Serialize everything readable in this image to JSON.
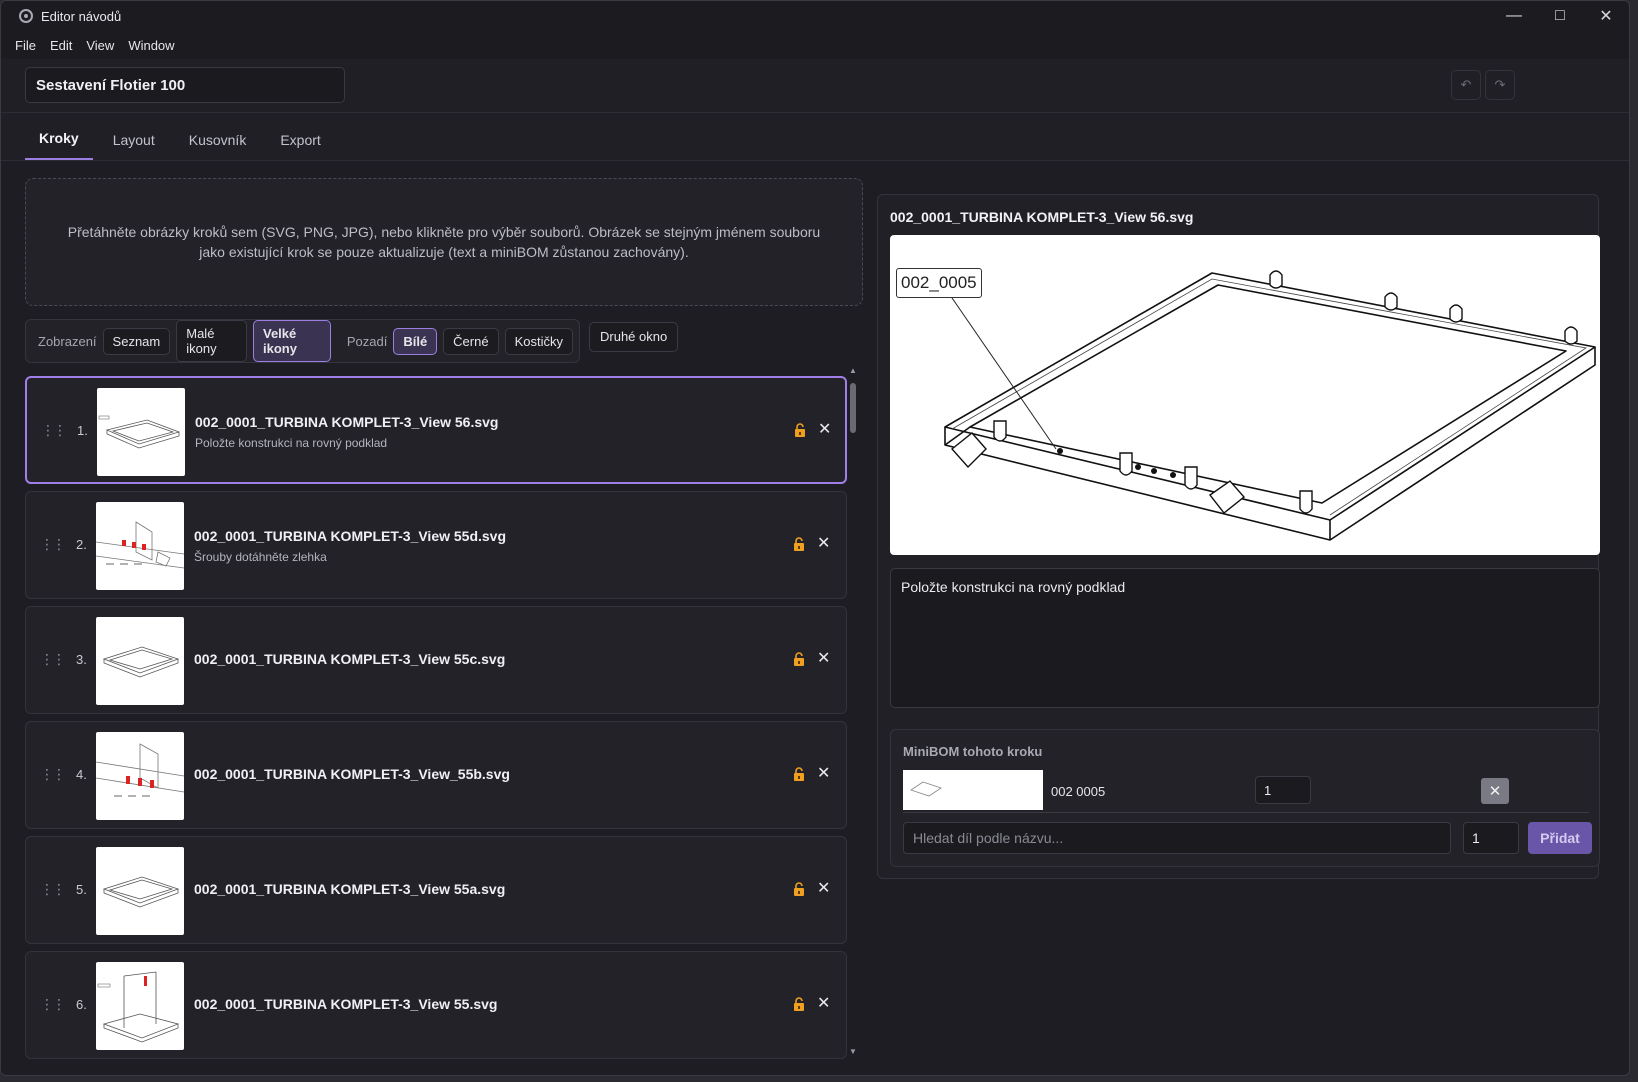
{
  "window": {
    "title": "Editor návodů"
  },
  "menu": [
    "File",
    "Edit",
    "View",
    "Window"
  ],
  "header": {
    "doc_title": "Sestavení Flotier 100"
  },
  "tabs": [
    {
      "label": "Kroky",
      "active": true
    },
    {
      "label": "Layout",
      "active": false
    },
    {
      "label": "Kusovník",
      "active": false
    },
    {
      "label": "Export",
      "active": false
    }
  ],
  "dropzone": {
    "text": "Přetáhněte obrázky kroků sem (SVG, PNG, JPG), nebo klikněte pro výběr souborů. Obrázek se stejným jménem souboru jako existující krok se pouze aktualizuje (text a miniBOM zůstanou zachovány)."
  },
  "view": {
    "display_label": "Zobrazení",
    "display_options": [
      {
        "label": "Seznam",
        "active": false
      },
      {
        "label": "Malé ikony",
        "active": false
      },
      {
        "label": "Velké ikony",
        "active": true
      }
    ],
    "background_label": "Pozadí",
    "background_options": [
      {
        "label": "Bílé",
        "active": true
      },
      {
        "label": "Černé",
        "active": false
      },
      {
        "label": "Kostičky",
        "active": false
      }
    ],
    "second_window": "Druhé okno"
  },
  "steps": [
    {
      "num": "1.",
      "name": "002_0001_TURBINA KOMPLET-3_View 56.svg",
      "desc": "Položte konstrukci na rovný podklad"
    },
    {
      "num": "2.",
      "name": "002_0001_TURBINA KOMPLET-3_View 55d.svg",
      "desc": "Šrouby dotáhněte zlehka"
    },
    {
      "num": "3.",
      "name": "002_0001_TURBINA KOMPLET-3_View 55c.svg",
      "desc": ""
    },
    {
      "num": "4.",
      "name": "002_0001_TURBINA KOMPLET-3_View_55b.svg",
      "desc": ""
    },
    {
      "num": "5.",
      "name": "002_0001_TURBINA KOMPLET-3_View 55a.svg",
      "desc": ""
    },
    {
      "num": "6.",
      "name": "002_0001_TURBINA KOMPLET-3_View 55.svg",
      "desc": ""
    }
  ],
  "detail": {
    "title": "002_0001_TURBINA KOMPLET-3_View 56.svg",
    "callout": "002_0005",
    "description": "Položte konstrukci na rovný podklad"
  },
  "minibom": {
    "title": "MiniBOM tohoto kroku",
    "rows": [
      {
        "part": "002 0005",
        "qty": "1"
      }
    ],
    "search_placeholder": "Hledat díl podle názvu...",
    "new_qty": "1",
    "add_label": "Přidat"
  },
  "colors": {
    "accent": "#9b7fe0",
    "lock": "#f0a020"
  }
}
